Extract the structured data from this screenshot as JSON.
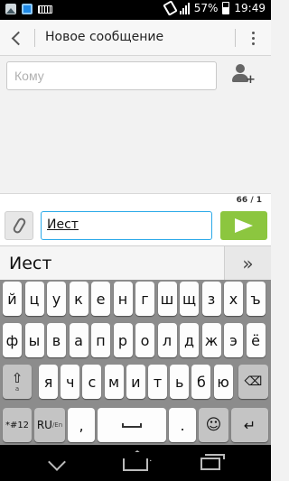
{
  "status_bar": {
    "battery": "57%",
    "time": "19:49",
    "left_icons": [
      "gallery-icon",
      "app-notification-icon",
      "keyboard-icon"
    ],
    "right_icons": [
      "screen-rotation-icon",
      "signal-icon",
      "battery-icon"
    ]
  },
  "action_bar": {
    "title": "Новое сообщение",
    "back_icon": "back-chevron-icon",
    "overflow_icon": "overflow-menu-icon"
  },
  "recipient": {
    "placeholder": "Кому",
    "add_contact_icon": "add-contact-icon"
  },
  "compose": {
    "counter": "66 / 1",
    "message_text": "Иест",
    "attach_icon": "paperclip-icon",
    "send_icon": "send-icon",
    "send_color": "#8cc63f"
  },
  "suggestions": {
    "word": "Иест",
    "expand_label": "»"
  },
  "keyboard": {
    "row1": [
      "й",
      "ц",
      "у",
      "к",
      "е",
      "н",
      "г",
      "ш",
      "щ",
      "з",
      "х",
      "ъ"
    ],
    "row2": [
      "ф",
      "ы",
      "в",
      "а",
      "п",
      "р",
      "о",
      "л",
      "д",
      "ж",
      "э",
      "ё"
    ],
    "row3": [
      "я",
      "ч",
      "с",
      "м",
      "и",
      "т",
      "ь",
      "б",
      "ю"
    ],
    "shift_sub": "a",
    "symbols_label": "*#12",
    "lang_label": "RU",
    "lang_sub": "/En",
    "comma": ",",
    "period": ".",
    "shift_icon": "shift-icon",
    "backspace_icon": "backspace-icon",
    "space_icon": "space-icon",
    "emoji_icon": "emoji-icon",
    "enter_icon": "enter-icon"
  },
  "nav_bar": {
    "icons": [
      "back-icon",
      "home-icon",
      "recent-apps-icon"
    ]
  }
}
